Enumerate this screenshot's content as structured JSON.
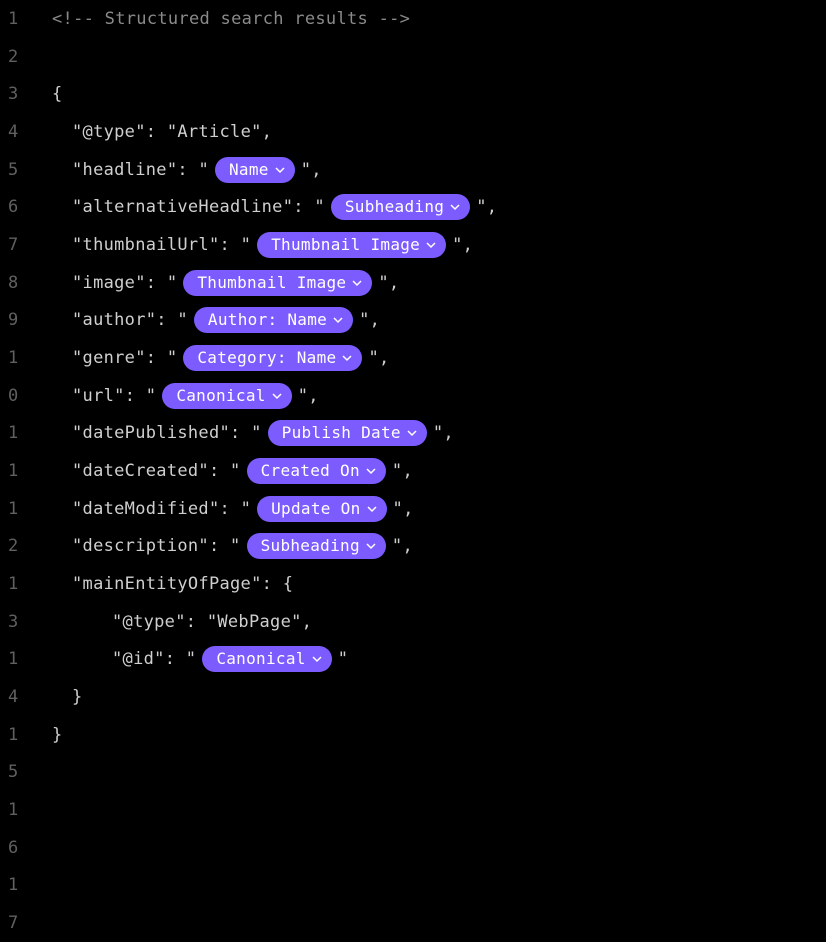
{
  "lineNumbers": [
    "1",
    "2",
    "3",
    "4",
    "5",
    "6",
    "7",
    "8",
    "9",
    "1",
    "0",
    "1",
    "1",
    "1",
    "2",
    "1",
    "3",
    "1",
    "4",
    "1",
    "5",
    "1",
    "6",
    "1",
    "7"
  ],
  "comment": "<!-- Structured search results -->",
  "lines": {
    "l3": "{",
    "l4_key": "\"@type\"",
    "l4_val": "\"Article\"",
    "l5_key": "\"headline\"",
    "l6_key": "\"alternativeHeadline\"",
    "l7_key": "\"thumbnailUrl\"",
    "l8_key": "\"image\"",
    "l9_key": "\"author\"",
    "l10_key": "\"genre\"",
    "l11_key": "\"url\"",
    "l12_key": "\"datePublished\"",
    "l13_key": "\"dateCreated\"",
    "l14_key": "\"dateModified\"",
    "l15_key": "\"description\"",
    "l16_key": "\"mainEntityOfPage\"",
    "l17_key": "\"@type\"",
    "l17_val": "\"WebPage\"",
    "l18_key": "\"@id\"",
    "l19": "}",
    "l20": "}"
  },
  "pills": {
    "name": "Name",
    "subheading": "Subheading",
    "thumbnail": "Thumbnail Image",
    "author": "Author: Name",
    "category": "Category: Name",
    "canonical": "Canonical",
    "publishDate": "Publish Date",
    "createdOn": "Created On",
    "updateOn": "Update On"
  },
  "punct": {
    "open_brace": "{",
    "close_brace": "}",
    "colon_space": ": ",
    "comma": ",",
    "quote": "\"",
    "quote_comma": "\","
  }
}
